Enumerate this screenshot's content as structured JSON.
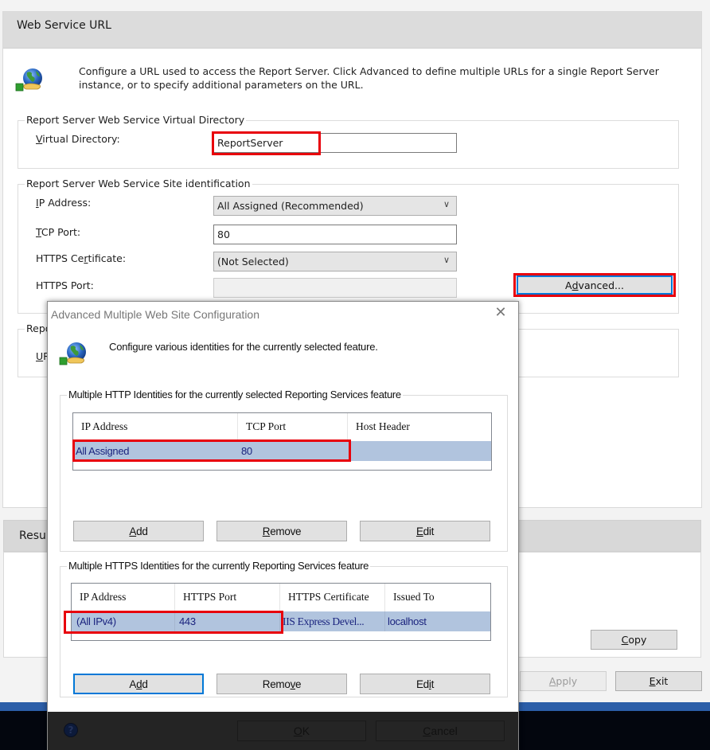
{
  "main": {
    "section_title": "Web Service URL",
    "globe_icon": "globe-hand-icon",
    "description": "Configure a URL used to access the Report Server.  Click Advanced to define multiple URLs for a single Report Server instance, or to specify additional parameters on the URL.",
    "virtual_directory_group": {
      "title": "Report Server Web Service Virtual Directory",
      "label": "Virtual Directory:",
      "label_accel": "V",
      "label_rest": "irtual Directory:",
      "value": "ReportServer"
    },
    "site_identification_group": {
      "title": "Report Server Web Service Site identification",
      "ip_address": {
        "accel": "I",
        "rest": "P Address:",
        "value": "All Assigned (Recommended)"
      },
      "tcp_port": {
        "accel": "T",
        "rest": "CP Port:",
        "value": "80"
      },
      "https_certificate": {
        "pre": "HTTPS Ce",
        "accel": "r",
        "rest": "tificate:",
        "value": "(Not Selected)"
      },
      "https_port": {
        "label": "HTTPS Port:",
        "value": ""
      },
      "advanced_button": {
        "pre": "A",
        "accel": "d",
        "rest": "vanced..."
      }
    },
    "urls_group": {
      "title_partial": "Repo",
      "label_partial_accel": "U",
      "label_partial_rest": "R"
    },
    "results": {
      "header_partial": "Resu",
      "copy_button": {
        "accel": "C",
        "rest": "opy"
      }
    },
    "apply_button": {
      "accel": "A",
      "rest": "pply"
    },
    "exit_button": {
      "accel": "E",
      "rest": "xit"
    }
  },
  "dialog": {
    "title": "Advanced Multiple Web Site Configuration",
    "close_glyph": "✕",
    "description": "Configure various identities for the currently selected feature.",
    "http_group": {
      "title": "Multiple HTTP Identities for the currently selected Reporting Services feature",
      "columns": [
        "IP Address",
        "TCP Port",
        "Host Header"
      ],
      "rows": [
        {
          "ip_address": "All Assigned",
          "tcp_port": "80",
          "host_header": ""
        }
      ],
      "buttons": {
        "add": {
          "accel": "A",
          "rest": "dd"
        },
        "remove": {
          "accel": "R",
          "rest": "emove"
        },
        "edit": {
          "accel": "E",
          "rest": "dit"
        }
      }
    },
    "https_group": {
      "title": "Multiple HTTPS Identities for the currently Reporting Services feature",
      "columns": [
        "IP Address",
        "HTTPS Port",
        "HTTPS Certificate",
        "Issued To"
      ],
      "rows": [
        {
          "ip_address": "(All IPv4)",
          "https_port": "443",
          "https_certificate": "IIS Express Devel...",
          "issued_to": "localhost"
        }
      ],
      "buttons": {
        "add": {
          "pre": "A",
          "accel": "d",
          "rest": "d"
        },
        "remove": {
          "pre": "Remo",
          "accel": "v",
          "rest": "e"
        },
        "edit": {
          "pre": "Ed",
          "accel": "i",
          "rest": "t"
        }
      }
    },
    "footer": {
      "help_glyph": "?",
      "ok": {
        "accel": "O",
        "rest": "K"
      },
      "cancel": {
        "accel": "C",
        "rest": "ancel"
      }
    }
  },
  "colors": {
    "highlight_red": "#e8000b",
    "selection_row": "#b1c4de",
    "focus_blue": "#0078d7",
    "taskbar_blue": "#2c5ea8"
  }
}
